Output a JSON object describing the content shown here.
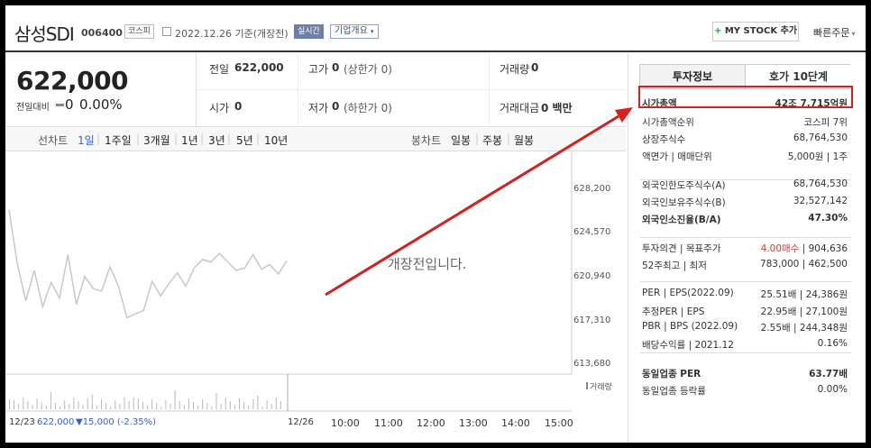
{
  "header": {
    "stock_name": "삼성SDI",
    "stock_code": "006400",
    "market": "코스피",
    "date": "2022.12.26 기준(개장전)",
    "realtime": "실시간",
    "company_info": "기업개요",
    "mystock": "MY STOCK 추가",
    "quick_order": "빠른주문"
  },
  "quote": {
    "price": "622,000",
    "change_label": "전일대비",
    "change_value": "0",
    "change_pct": "0.00%"
  },
  "stats": {
    "prev_label": "전일",
    "prev_value": "622,000",
    "high_label": "고가",
    "high_value": "0",
    "high_sub": "(상한가 0)",
    "volume_label": "거래량",
    "volume_value": "0",
    "open_label": "시가",
    "open_value": "0",
    "low_label": "저가",
    "low_value": "0",
    "low_sub": "(하한가 0)",
    "amount_label": "거래대금",
    "amount_value": "0 백만"
  },
  "toolbar": {
    "line_label": "선차트",
    "periods": [
      "1일",
      "1주일",
      "3개월",
      "1년",
      "3년",
      "5년",
      "10년"
    ],
    "candle_label": "봉차트",
    "candles": [
      "일봉",
      "주봉",
      "월봉"
    ]
  },
  "chart": {
    "notice": "개장전입니다.",
    "volume_label": "거래량",
    "y_ticks": [
      "628,200",
      "624,570",
      "620,940",
      "617,310",
      "613,680"
    ],
    "x_ticks": [
      "12/26",
      "10:00",
      "11:00",
      "12:00",
      "13:00",
      "14:00",
      "15:00"
    ],
    "footer_date": "12/23",
    "footer_price": "622,000",
    "footer_change": "▼15,000 (-2.35%)"
  },
  "chart_data": {
    "type": "line",
    "title": "",
    "x_ticks": [
      "12/26",
      "10:00",
      "11:00",
      "12:00",
      "13:00",
      "14:00",
      "15:00"
    ],
    "ylim": [
      613680,
      628200
    ],
    "y_ticks": [
      628200,
      624570,
      620940,
      617310,
      613680
    ],
    "series": [
      {
        "values": [
          626500,
          622000,
          619000,
          621500,
          618500,
          620500,
          619200,
          622800,
          618700,
          621000,
          620000,
          619800,
          621800,
          620200,
          617600,
          617900,
          618200,
          620600,
          619400,
          620400,
          621300,
          620200,
          621700,
          622400,
          622200,
          622900,
          622200,
          621500,
          621700,
          622800,
          621600,
          622000,
          621200,
          622300
        ]
      }
    ]
  },
  "panel": {
    "tab_active": "투자정보",
    "tab_other": "호가 10단계",
    "rows": [
      {
        "label": "시가총액",
        "value": "42조 7,715억원"
      },
      {
        "label": "시가총액순위",
        "value": "코스피 7위"
      },
      {
        "label": "상장주식수",
        "value": "68,764,530"
      },
      {
        "label": "액면가 | 매매단위",
        "value": "5,000원 | 1주"
      },
      {
        "label": "외국인한도주식수(A)",
        "value": "68,764,530"
      },
      {
        "label": "외국인보유주식수(B)",
        "value": "32,527,142"
      },
      {
        "label": "외국인소진율(B/A)",
        "value": "47.30%"
      },
      {
        "label": "투자의견 | 목표주가",
        "value_red": "4.00매수",
        "value": "904,636"
      },
      {
        "label": "52주최고 | 최저",
        "value": "783,000 | 462,500"
      },
      {
        "label": "PER | EPS(2022.09)",
        "value": "25.51배 | 24,386원"
      },
      {
        "label": "추정PER | EPS",
        "value": "22.95배 | 27,100원"
      },
      {
        "label": "PBR | BPS (2022.09)",
        "value": "2.55배 | 244,348원"
      },
      {
        "label": "배당수익률 | 2021.12",
        "value": "0.16%"
      },
      {
        "label": "동일업종 PER",
        "value": "63.77배"
      },
      {
        "label": "동일업종 등락률",
        "value": "0.00%"
      }
    ]
  },
  "colors": {
    "accent": "#3a5fc8",
    "down": "#3a5fc8",
    "up": "#d23a3a",
    "highlight_box": "#d42020",
    "arrow": "#d42020"
  }
}
